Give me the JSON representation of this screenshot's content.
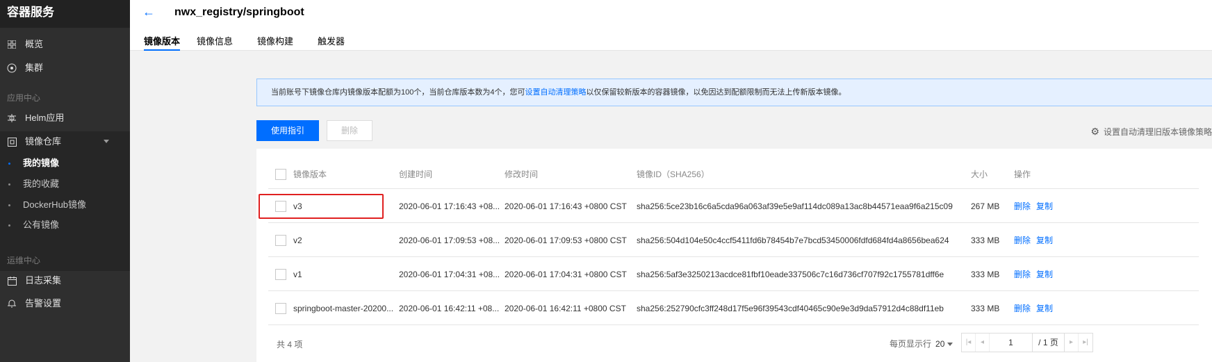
{
  "sidebar": {
    "title": "容器服务",
    "items": [
      {
        "label": "概览",
        "icon": "grid-icon"
      },
      {
        "label": "集群",
        "icon": "cluster-icon"
      }
    ],
    "section_app": "应用中心",
    "helm": "Helm应用",
    "registry": "镜像仓库",
    "sub_items": [
      "我的镜像",
      "我的收藏",
      "DockerHub镜像",
      "公有镜像"
    ],
    "section_ops": "运维中心",
    "logs": "日志采集",
    "alerts": "告警设置"
  },
  "header": {
    "title": "nwx_registry/springboot",
    "tabs": [
      "镜像版本",
      "镜像信息",
      "镜像构建",
      "触发器"
    ]
  },
  "notice": {
    "text_before": "当前账号下镜像仓库内镜像版本配额为100个，当前仓库版本数为4个，您可",
    "link": "设置自动清理策略",
    "text_after": "以仅保留较新版本的容器镜像，以免因达到配额限制而无法上传新版本镜像。"
  },
  "toolbar": {
    "guide_label": "使用指引",
    "delete_label": "删除",
    "policy_label": "设置自动清理旧版本镜像策略"
  },
  "table": {
    "columns": [
      "镜像版本",
      "创建时间",
      "修改时间",
      "镜像ID（SHA256）",
      "大小",
      "操作"
    ],
    "rows": [
      {
        "version": "v3",
        "created": "2020-06-01 17:16:43 +08...",
        "modified": "2020-06-01 17:16:43 +0800 CST",
        "id": "sha256:5ce23b16c6a5cda96a063af39e5e9af114dc089a13ac8b44571eaa9f6a215c09",
        "size": "267 MB",
        "op_delete": "删除",
        "op_copy": "复制"
      },
      {
        "version": "v2",
        "created": "2020-06-01 17:09:53 +08...",
        "modified": "2020-06-01 17:09:53 +0800 CST",
        "id": "sha256:504d104e50c4ccf5411fd6b78454b7e7bcd53450006fdfd684fd4a8656bea624",
        "size": "333 MB",
        "op_delete": "删除",
        "op_copy": "复制"
      },
      {
        "version": "v1",
        "created": "2020-06-01 17:04:31 +08...",
        "modified": "2020-06-01 17:04:31 +0800 CST",
        "id": "sha256:5af3e3250213acdce81fbf10eade337506c7c16d736cf707f92c1755781dff6e",
        "size": "333 MB",
        "op_delete": "删除",
        "op_copy": "复制"
      },
      {
        "version": "springboot-master-20200...",
        "created": "2020-06-01 16:42:11 +08...",
        "modified": "2020-06-01 16:42:11 +0800 CST",
        "id": "sha256:252790cfc3ff248d17f5e96f39543cdf40465c90e9e3d9da57912d4c88df11eb",
        "size": "333 MB",
        "op_delete": "删除",
        "op_copy": "复制"
      }
    ]
  },
  "footer": {
    "total": "共 4 项",
    "page_size_label": "每页显示行",
    "page_size": "20",
    "current_page": "1",
    "total_pages": "/ 1 页"
  },
  "colors": {
    "accent": "#006eff",
    "sidebar_bg": "#2f2f2f",
    "highlight": "#e02020"
  }
}
